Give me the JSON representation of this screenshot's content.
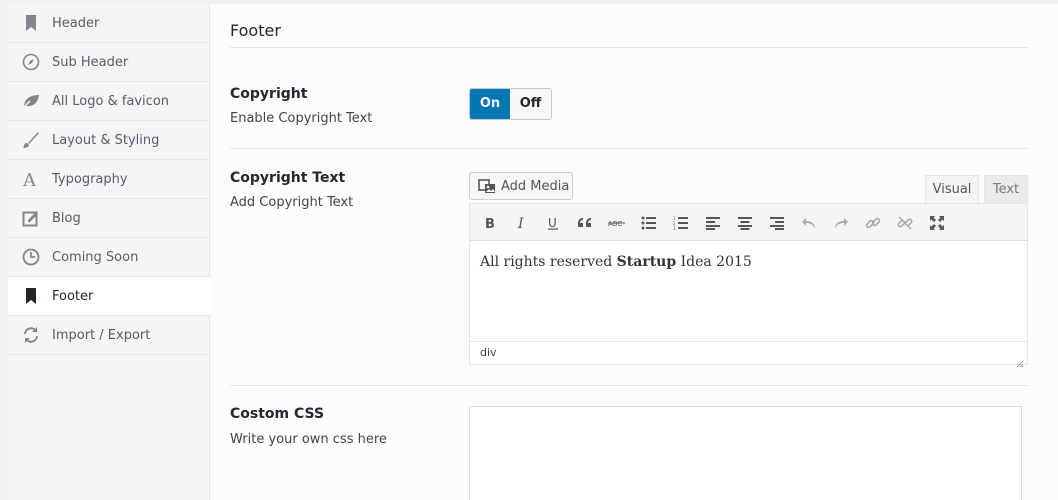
{
  "sidebar": {
    "items": [
      {
        "label": "Header",
        "icon": "bookmark-icon"
      },
      {
        "label": "Sub Header",
        "icon": "compass-icon"
      },
      {
        "label": "All Logo & favicon",
        "icon": "leaf-icon"
      },
      {
        "label": "Layout & Styling",
        "icon": "brush-icon"
      },
      {
        "label": "Typography",
        "icon": "typography-icon"
      },
      {
        "label": "Blog",
        "icon": "edit-icon"
      },
      {
        "label": "Coming Soon",
        "icon": "clock-icon"
      },
      {
        "label": "Footer",
        "icon": "bookmark-icon",
        "active": true
      },
      {
        "label": "Import / Export",
        "icon": "refresh-icon"
      }
    ]
  },
  "main": {
    "title": "Footer",
    "copyright": {
      "title": "Copyright",
      "desc": "Enable Copyright Text",
      "on_label": "On",
      "off_label": "Off",
      "state": "On"
    },
    "copyright_text": {
      "title": "Copyright Text",
      "desc": "Add Copyright Text",
      "add_media_label": "Add Media",
      "tab_visual": "Visual",
      "tab_text": "Text",
      "content_before": "All rights reserved ",
      "content_bold": "Startup",
      "content_after": " Idea 2015",
      "status_path": "div"
    },
    "custom_css": {
      "title": "Costom CSS",
      "desc": "Write your own css here",
      "value": ""
    }
  },
  "colors": {
    "accent": "#0078b5",
    "icon": "#777777",
    "icon_active": "#23282d"
  },
  "toolbar_icons": [
    "bold-icon",
    "italic-icon",
    "underline-icon",
    "blockquote-icon",
    "strikethrough-icon",
    "bullet-list-icon",
    "numbered-list-icon",
    "align-left-icon",
    "align-center-icon",
    "align-right-icon",
    "undo-icon",
    "redo-icon",
    "link-icon",
    "unlink-icon",
    "fullscreen-icon"
  ]
}
